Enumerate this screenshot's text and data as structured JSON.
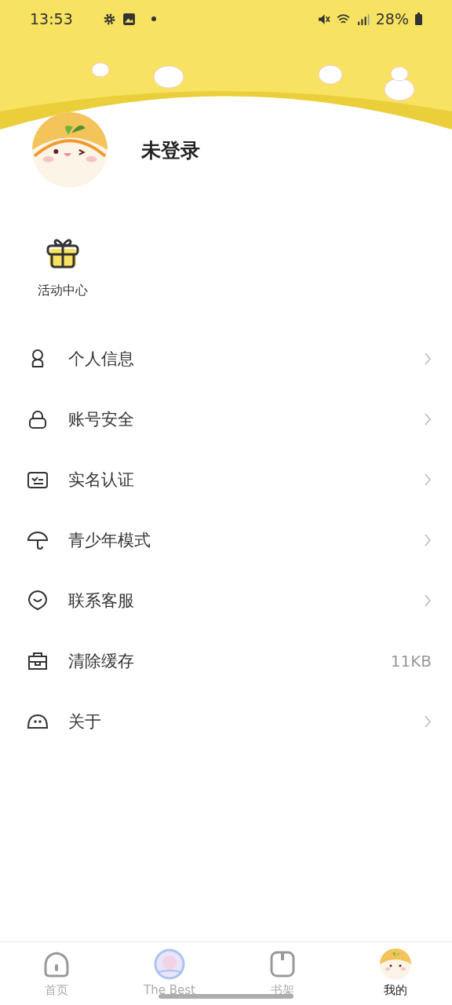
{
  "status_bar": {
    "time": "13:53",
    "battery": "28%"
  },
  "profile": {
    "name": "未登录"
  },
  "shortcuts": [
    {
      "label": "活动中心"
    }
  ],
  "menu": [
    {
      "label": "个人信息",
      "kind": "link"
    },
    {
      "label": "账号安全",
      "kind": "link"
    },
    {
      "label": "实名认证",
      "kind": "link"
    },
    {
      "label": "青少年模式",
      "kind": "link"
    },
    {
      "label": "联系客服",
      "kind": "link"
    },
    {
      "label": "清除缓存",
      "kind": "value",
      "value": "11KB"
    },
    {
      "label": "关于",
      "kind": "link"
    }
  ],
  "tabs": [
    {
      "label": "首页",
      "selected": false
    },
    {
      "label": "The Best",
      "selected": false
    },
    {
      "label": "书架",
      "selected": false
    },
    {
      "label": "我的",
      "selected": true
    }
  ]
}
